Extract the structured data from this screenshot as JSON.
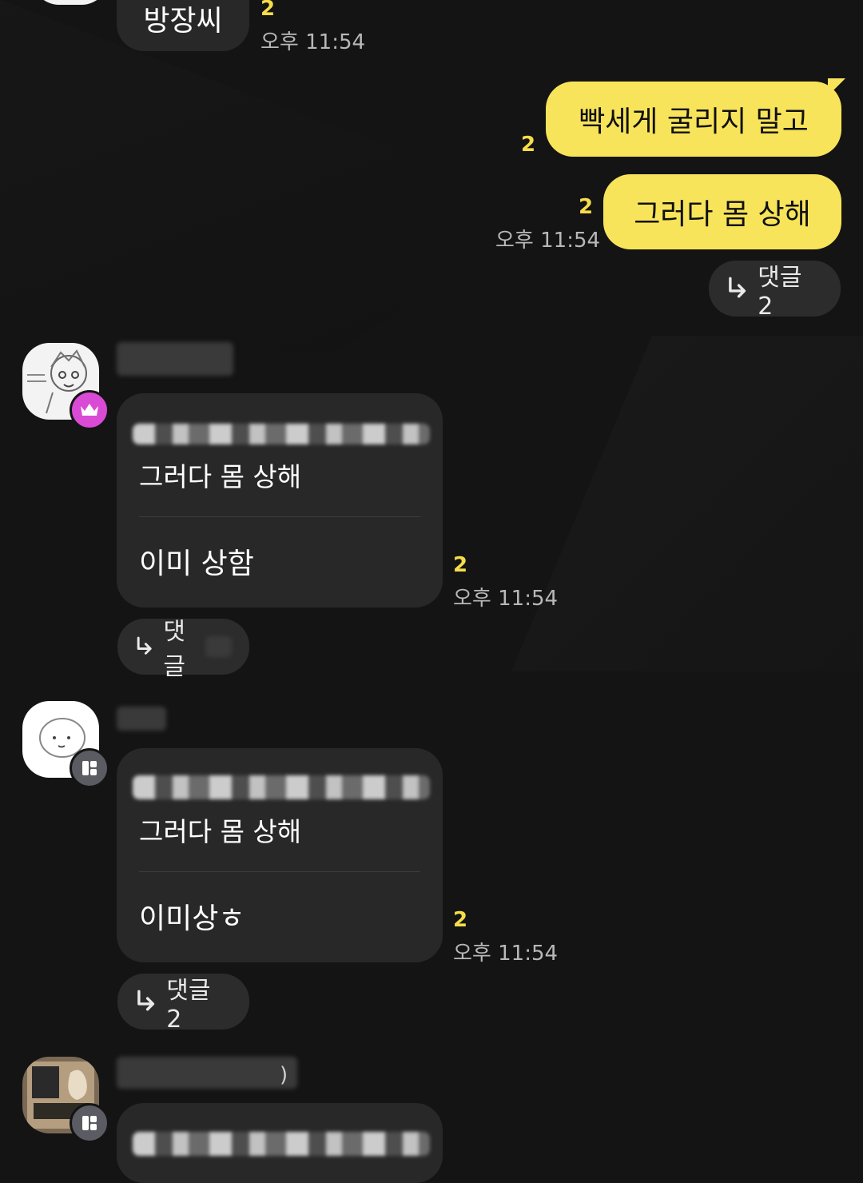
{
  "messages": {
    "top": {
      "text": "방장씨",
      "unread": "2",
      "time": "오후 11:54"
    },
    "mine": [
      {
        "text": "빡세게 굴리지 말고",
        "unread": "2"
      },
      {
        "text": "그러다 몸 상해",
        "unread": "2",
        "time": "오후 11:54"
      }
    ],
    "mine_reply": "댓글 2",
    "thread1": {
      "quoted": "그러다 몸 상해",
      "reply": "이미 상함",
      "unread": "2",
      "time": "오후 11:54",
      "reply_pill": "댓글"
    },
    "thread2": {
      "quoted": "그러다 몸 상해",
      "reply": "이미상ㅎ",
      "unread": "2",
      "time": "오후 11:54",
      "reply_pill": "댓글 2"
    },
    "thread3_name_suffix": ")"
  },
  "icons": {
    "reply": "reply-arrow-icon",
    "crown": "crown-icon",
    "app": "app-badge-icon"
  },
  "colors": {
    "background": "#141414",
    "bubble_dark": "#282828",
    "bubble_mine": "#f8e45a",
    "unread": "#f6dd4a",
    "crown_badge": "#d94bd4"
  }
}
